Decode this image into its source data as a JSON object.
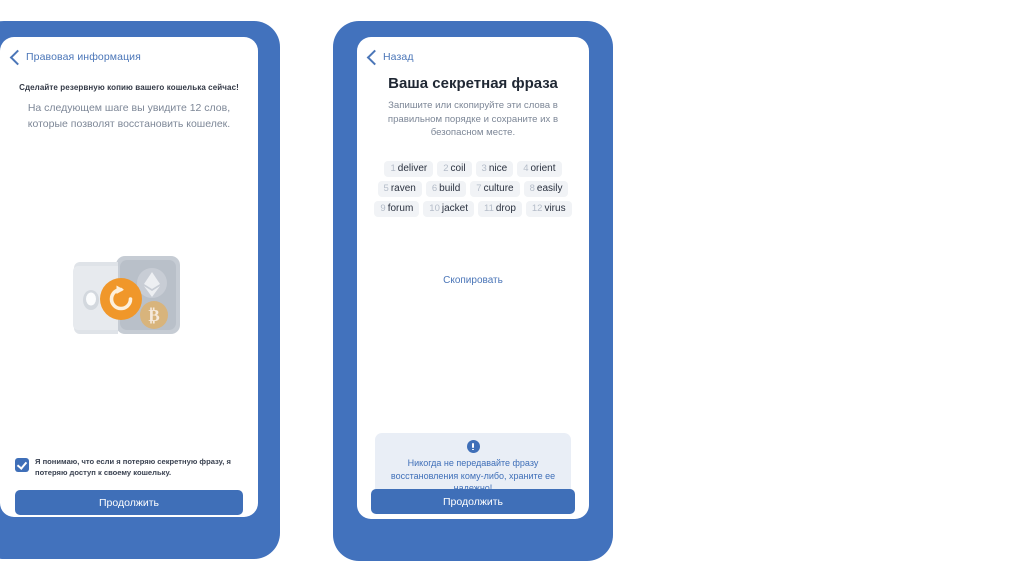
{
  "theme": {
    "frame_blue": "#4272bd",
    "accent_blue": "#3f6fb8",
    "link_blue": "#4b76b8",
    "muted_text": "#7d8797",
    "chip_bg": "#f1f3f6",
    "warning_bg": "#e9eef6",
    "orange": "#f0972a",
    "page_bg": "#ffffff"
  },
  "legal_screen": {
    "back_label": "Правовая информация",
    "back_icon": "chevron-left-icon",
    "heading": "Сделайте резервную копию вашего кошелька сейчас!",
    "subtext": "На следующем шаге вы увидите 12 слов, которые позволят восстановить кошелек.",
    "illustration": {
      "name": "wallet-backup-illustration",
      "parts": [
        "wallet-body",
        "restore-refresh-icon",
        "ethereum-icon",
        "bitcoin-icon"
      ]
    },
    "consent": {
      "checked": true,
      "label": "Я понимаю, что если я потеряю секретную фразу, я потеряю доступ к своему кошельку."
    },
    "continue_label": "Продолжить"
  },
  "seed_screen": {
    "back_label": "Назад",
    "back_icon": "chevron-left-icon",
    "title": "Ваша секретная фраза",
    "subtext": "Запишите или скопируйте эти слова в правильном порядке и сохраните их в безопасном месте.",
    "words": [
      {
        "index": "1",
        "word": "deliver"
      },
      {
        "index": "2",
        "word": "coil"
      },
      {
        "index": "3",
        "word": "nice"
      },
      {
        "index": "4",
        "word": "orient"
      },
      {
        "index": "5",
        "word": "raven"
      },
      {
        "index": "6",
        "word": "build"
      },
      {
        "index": "7",
        "word": "culture"
      },
      {
        "index": "8",
        "word": "easily"
      },
      {
        "index": "9",
        "word": "forum"
      },
      {
        "index": "10",
        "word": "jacket"
      },
      {
        "index": "11",
        "word": "drop"
      },
      {
        "index": "12",
        "word": "virus"
      }
    ],
    "copy_label": "Скопировать",
    "warning": {
      "icon": "info-exclamation-icon",
      "text": "Никогда не передавайте фразу восстановления кому-либо, храните ее надежно!"
    },
    "continue_label": "Продолжить"
  }
}
